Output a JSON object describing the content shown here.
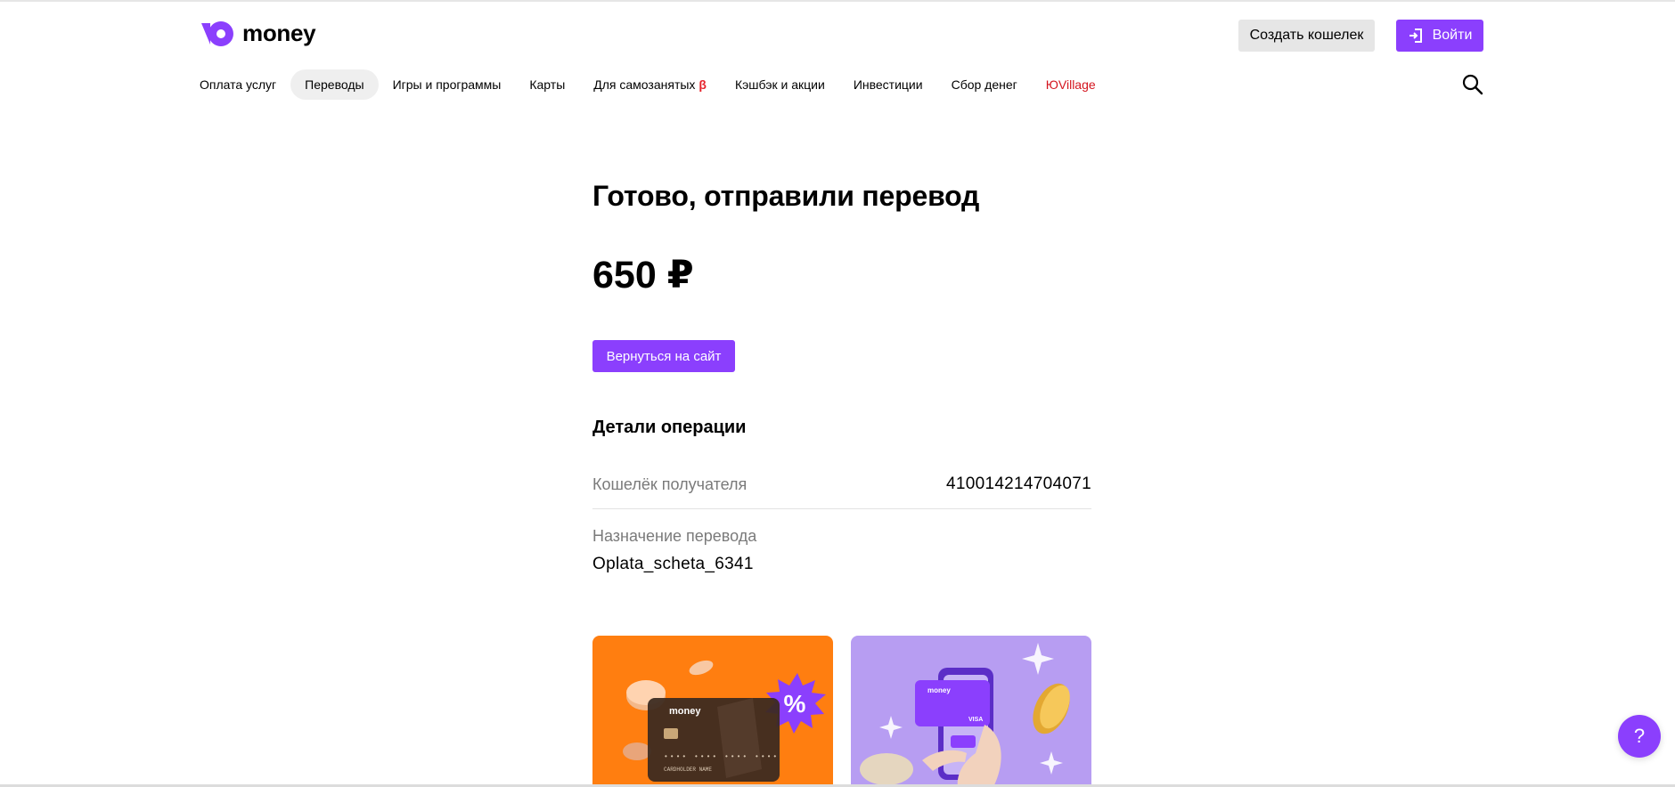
{
  "header": {
    "logo_text": "money",
    "create_wallet_label": "Создать кошелек",
    "login_label": "Войти"
  },
  "nav": {
    "items": [
      {
        "label": "Оплата услуг"
      },
      {
        "label": "Переводы",
        "active": true
      },
      {
        "label": "Игры и программы"
      },
      {
        "label": "Карты"
      },
      {
        "label": "Для самозанятых",
        "badge": "β"
      },
      {
        "label": "Кэшбэк и акции"
      },
      {
        "label": "Инвестиции"
      },
      {
        "label": "Сбор денег"
      },
      {
        "label": "ЮVillage",
        "highlight": true
      }
    ]
  },
  "main": {
    "title": "Готово, отправили перевод",
    "amount": "650 ₽",
    "back_button_label": "Вернуться на сайт",
    "details_title": "Детали операции",
    "recipient_wallet_label": "Кошелёк получателя",
    "recipient_wallet_value": "410014214704071",
    "purpose_label": "Назначение перевода",
    "purpose_value": "Oplata_scheta_6341"
  },
  "promo_cards": {
    "card1_brand": "money",
    "card1_holder": "CARDHOLDER NAME",
    "card1_badge": "%",
    "card2_brand": "money",
    "card2_network": "VISA"
  },
  "help": {
    "label": "?"
  },
  "colors": {
    "accent": "#8b3ffd",
    "orange": "#ff7e10",
    "lilac": "#b79df2",
    "highlight_red": "#d4151f"
  },
  "icons": [
    "yoomoney-logo-icon",
    "login-arrow-icon",
    "search-icon"
  ]
}
